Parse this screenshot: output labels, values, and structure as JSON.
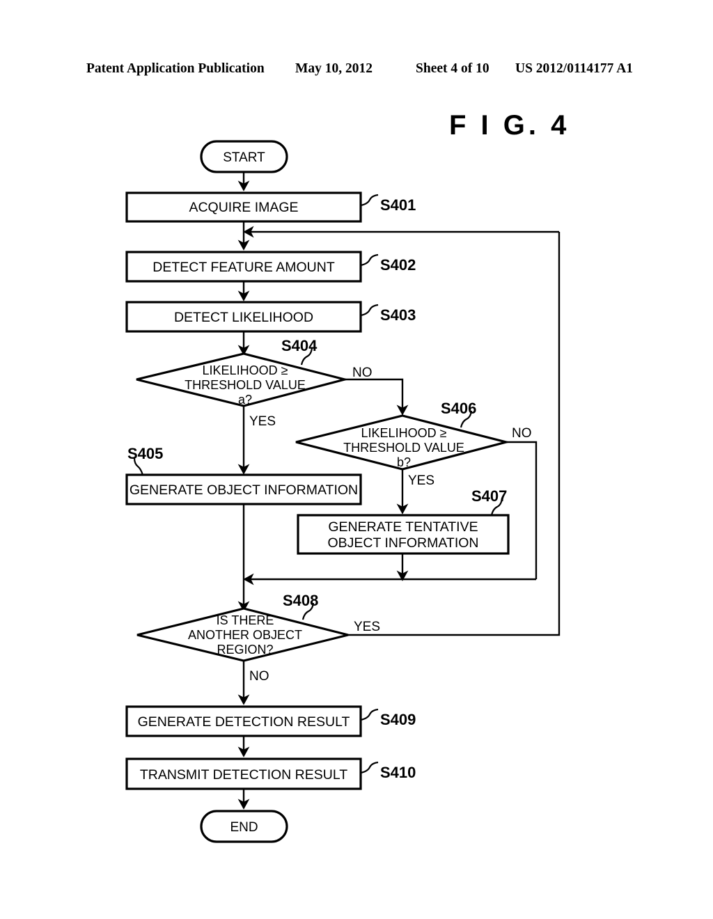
{
  "header": {
    "publication": "Patent Application Publication",
    "date": "May 10, 2012",
    "sheet": "Sheet 4 of 10",
    "patent_number": "US 2012/0114177 A1"
  },
  "figure": {
    "title": "F I G.  4"
  },
  "flowchart": {
    "type": "flowchart",
    "nodes": {
      "start": {
        "label": "START",
        "shape": "terminator"
      },
      "s401": {
        "label": "ACQUIRE IMAGE",
        "shape": "process",
        "step": "S401"
      },
      "s402": {
        "label": "DETECT FEATURE AMOUNT",
        "shape": "process",
        "step": "S402"
      },
      "s403": {
        "label": "DETECT LIKELIHOOD",
        "shape": "process",
        "step": "S403"
      },
      "s404": {
        "line1": "LIKELIHOOD ≥",
        "line2": "THRESHOLD VALUE",
        "line3": "a?",
        "shape": "decision",
        "step": "S404"
      },
      "s405": {
        "label": "GENERATE OBJECT INFORMATION",
        "shape": "process",
        "step": "S405"
      },
      "s406": {
        "line1": "LIKELIHOOD ≥",
        "line2": "THRESHOLD VALUE",
        "line3": "b?",
        "shape": "decision",
        "step": "S406"
      },
      "s407": {
        "line1": "GENERATE TENTATIVE",
        "line2": "OBJECT INFORMATION",
        "shape": "process",
        "step": "S407"
      },
      "s408": {
        "line1": "IS THERE",
        "line2": "ANOTHER OBJECT",
        "line3": "REGION?",
        "shape": "decision",
        "step": "S408"
      },
      "s409": {
        "label": "GENERATE DETECTION RESULT",
        "shape": "process",
        "step": "S409"
      },
      "s410": {
        "label": "TRANSMIT DETECTION RESULT",
        "shape": "process",
        "step": "S410"
      },
      "end": {
        "label": "END",
        "shape": "terminator"
      }
    },
    "branches": {
      "s404_yes": "YES",
      "s404_no": "NO",
      "s406_yes": "YES",
      "s406_no": "NO",
      "s408_yes": "YES",
      "s408_no": "NO"
    },
    "edges": [
      {
        "from": "start",
        "to": "s401",
        "label": ""
      },
      {
        "from": "s401",
        "to": "s402",
        "label": ""
      },
      {
        "from": "s402",
        "to": "s403",
        "label": ""
      },
      {
        "from": "s403",
        "to": "s404",
        "label": ""
      },
      {
        "from": "s404",
        "to": "s405",
        "label": "YES"
      },
      {
        "from": "s404",
        "to": "s406",
        "label": "NO"
      },
      {
        "from": "s406",
        "to": "s407",
        "label": "YES"
      },
      {
        "from": "s406",
        "to": "s408",
        "label": "NO"
      },
      {
        "from": "s405",
        "to": "s408",
        "label": ""
      },
      {
        "from": "s407",
        "to": "s408",
        "label": ""
      },
      {
        "from": "s408",
        "to": "s402",
        "label": "YES"
      },
      {
        "from": "s408",
        "to": "s409",
        "label": "NO"
      },
      {
        "from": "s409",
        "to": "s410",
        "label": ""
      },
      {
        "from": "s410",
        "to": "end",
        "label": ""
      }
    ],
    "colors": {
      "line": "#000000",
      "fill": "#ffffff",
      "background": "#ffffff"
    }
  }
}
